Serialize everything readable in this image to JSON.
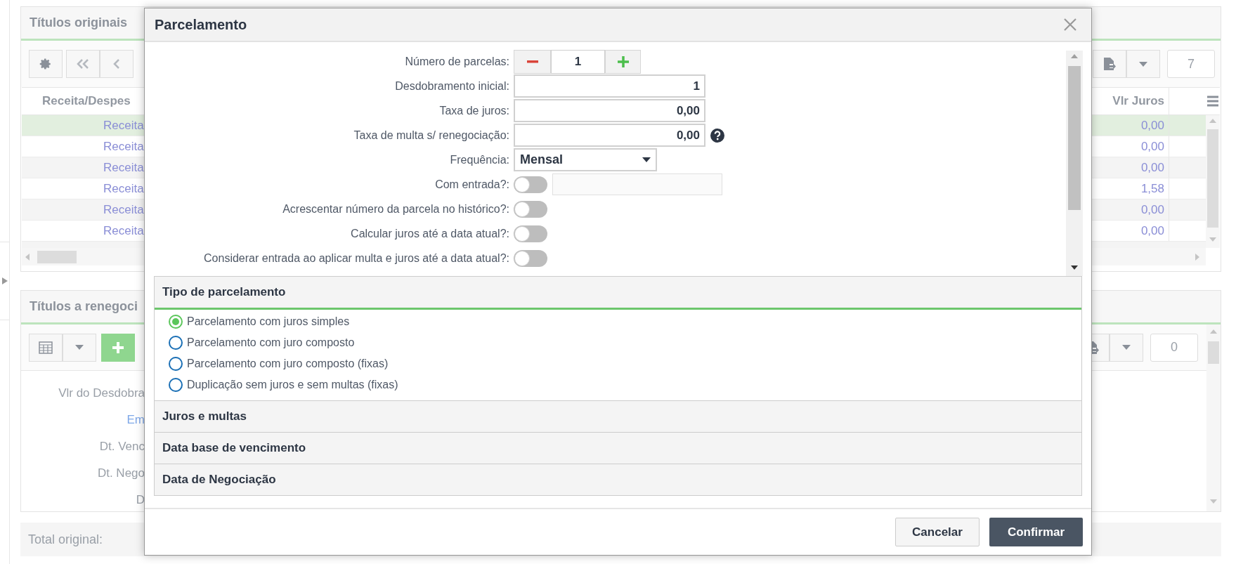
{
  "background": {
    "originals": {
      "title": "Títulos originais",
      "count": "7",
      "columns": [
        "Receita/Despes",
        "Vlr Juros"
      ],
      "rows": [
        {
          "type": "Receita",
          "interest": "0,00",
          "selected": true
        },
        {
          "type": "Receita",
          "interest": "0,00",
          "selected": false
        },
        {
          "type": "Receita",
          "interest": "0,00",
          "selected": false
        },
        {
          "type": "Receita",
          "interest": "1,58",
          "selected": false
        },
        {
          "type": "Receita",
          "interest": "0,00",
          "selected": false
        },
        {
          "type": "Receita",
          "interest": "0,00",
          "selected": false
        }
      ]
    },
    "renegotiate": {
      "title": "Títulos a renegoci",
      "count": "0",
      "labels": [
        {
          "text": "Vlr do Desdobra",
          "kind": "label"
        },
        {
          "text": "Em",
          "kind": "link"
        },
        {
          "text": "Dt. Venc",
          "kind": "label"
        },
        {
          "text": "Dt. Nego",
          "kind": "label"
        },
        {
          "text": "D",
          "kind": "label"
        }
      ]
    },
    "total": {
      "label": "Total original:"
    }
  },
  "dialog": {
    "title": "Parcelamento",
    "fields": [
      {
        "kind": "stepper",
        "label": "Número de parcelas:",
        "value": "1"
      },
      {
        "kind": "number",
        "label": "Desdobramento inicial:",
        "value": "1",
        "help": false
      },
      {
        "kind": "number",
        "label": "Taxa de juros:",
        "value": "0,00",
        "help": false
      },
      {
        "kind": "number",
        "label": "Taxa de multa s/ renegociação:",
        "value": "0,00",
        "help": true
      },
      {
        "kind": "select",
        "label": "Frequência:",
        "value": "Mensal"
      },
      {
        "kind": "toggle_input",
        "label": "Com entrada?:",
        "on": false
      },
      {
        "kind": "toggle",
        "label": "Acrescentar número da parcela no histórico?:",
        "on": false
      },
      {
        "kind": "toggle",
        "label": "Calcular juros até a data atual?:",
        "on": false
      },
      {
        "kind": "toggle",
        "label": "Considerar entrada ao aplicar multa e juros até a data atual?:",
        "on": false
      }
    ],
    "sections": [
      {
        "title": "Tipo de parcelamento",
        "expanded": true,
        "options": [
          {
            "label": "Parcelamento com juros simples",
            "selected": true
          },
          {
            "label": "Parcelamento com juro composto",
            "selected": false
          },
          {
            "label": "Parcelamento com juro composto (fixas)",
            "selected": false
          },
          {
            "label": "Duplicação sem juros e sem multas (fixas)",
            "selected": false
          }
        ]
      },
      {
        "title": "Juros e multas",
        "expanded": false
      },
      {
        "title": "Data base de vencimento",
        "expanded": false
      },
      {
        "title": "Data de Negociação",
        "expanded": false
      }
    ],
    "buttons": [
      {
        "label": "Cancelar",
        "kind": "secondary"
      },
      {
        "label": "Confirmar",
        "kind": "primary"
      }
    ]
  }
}
